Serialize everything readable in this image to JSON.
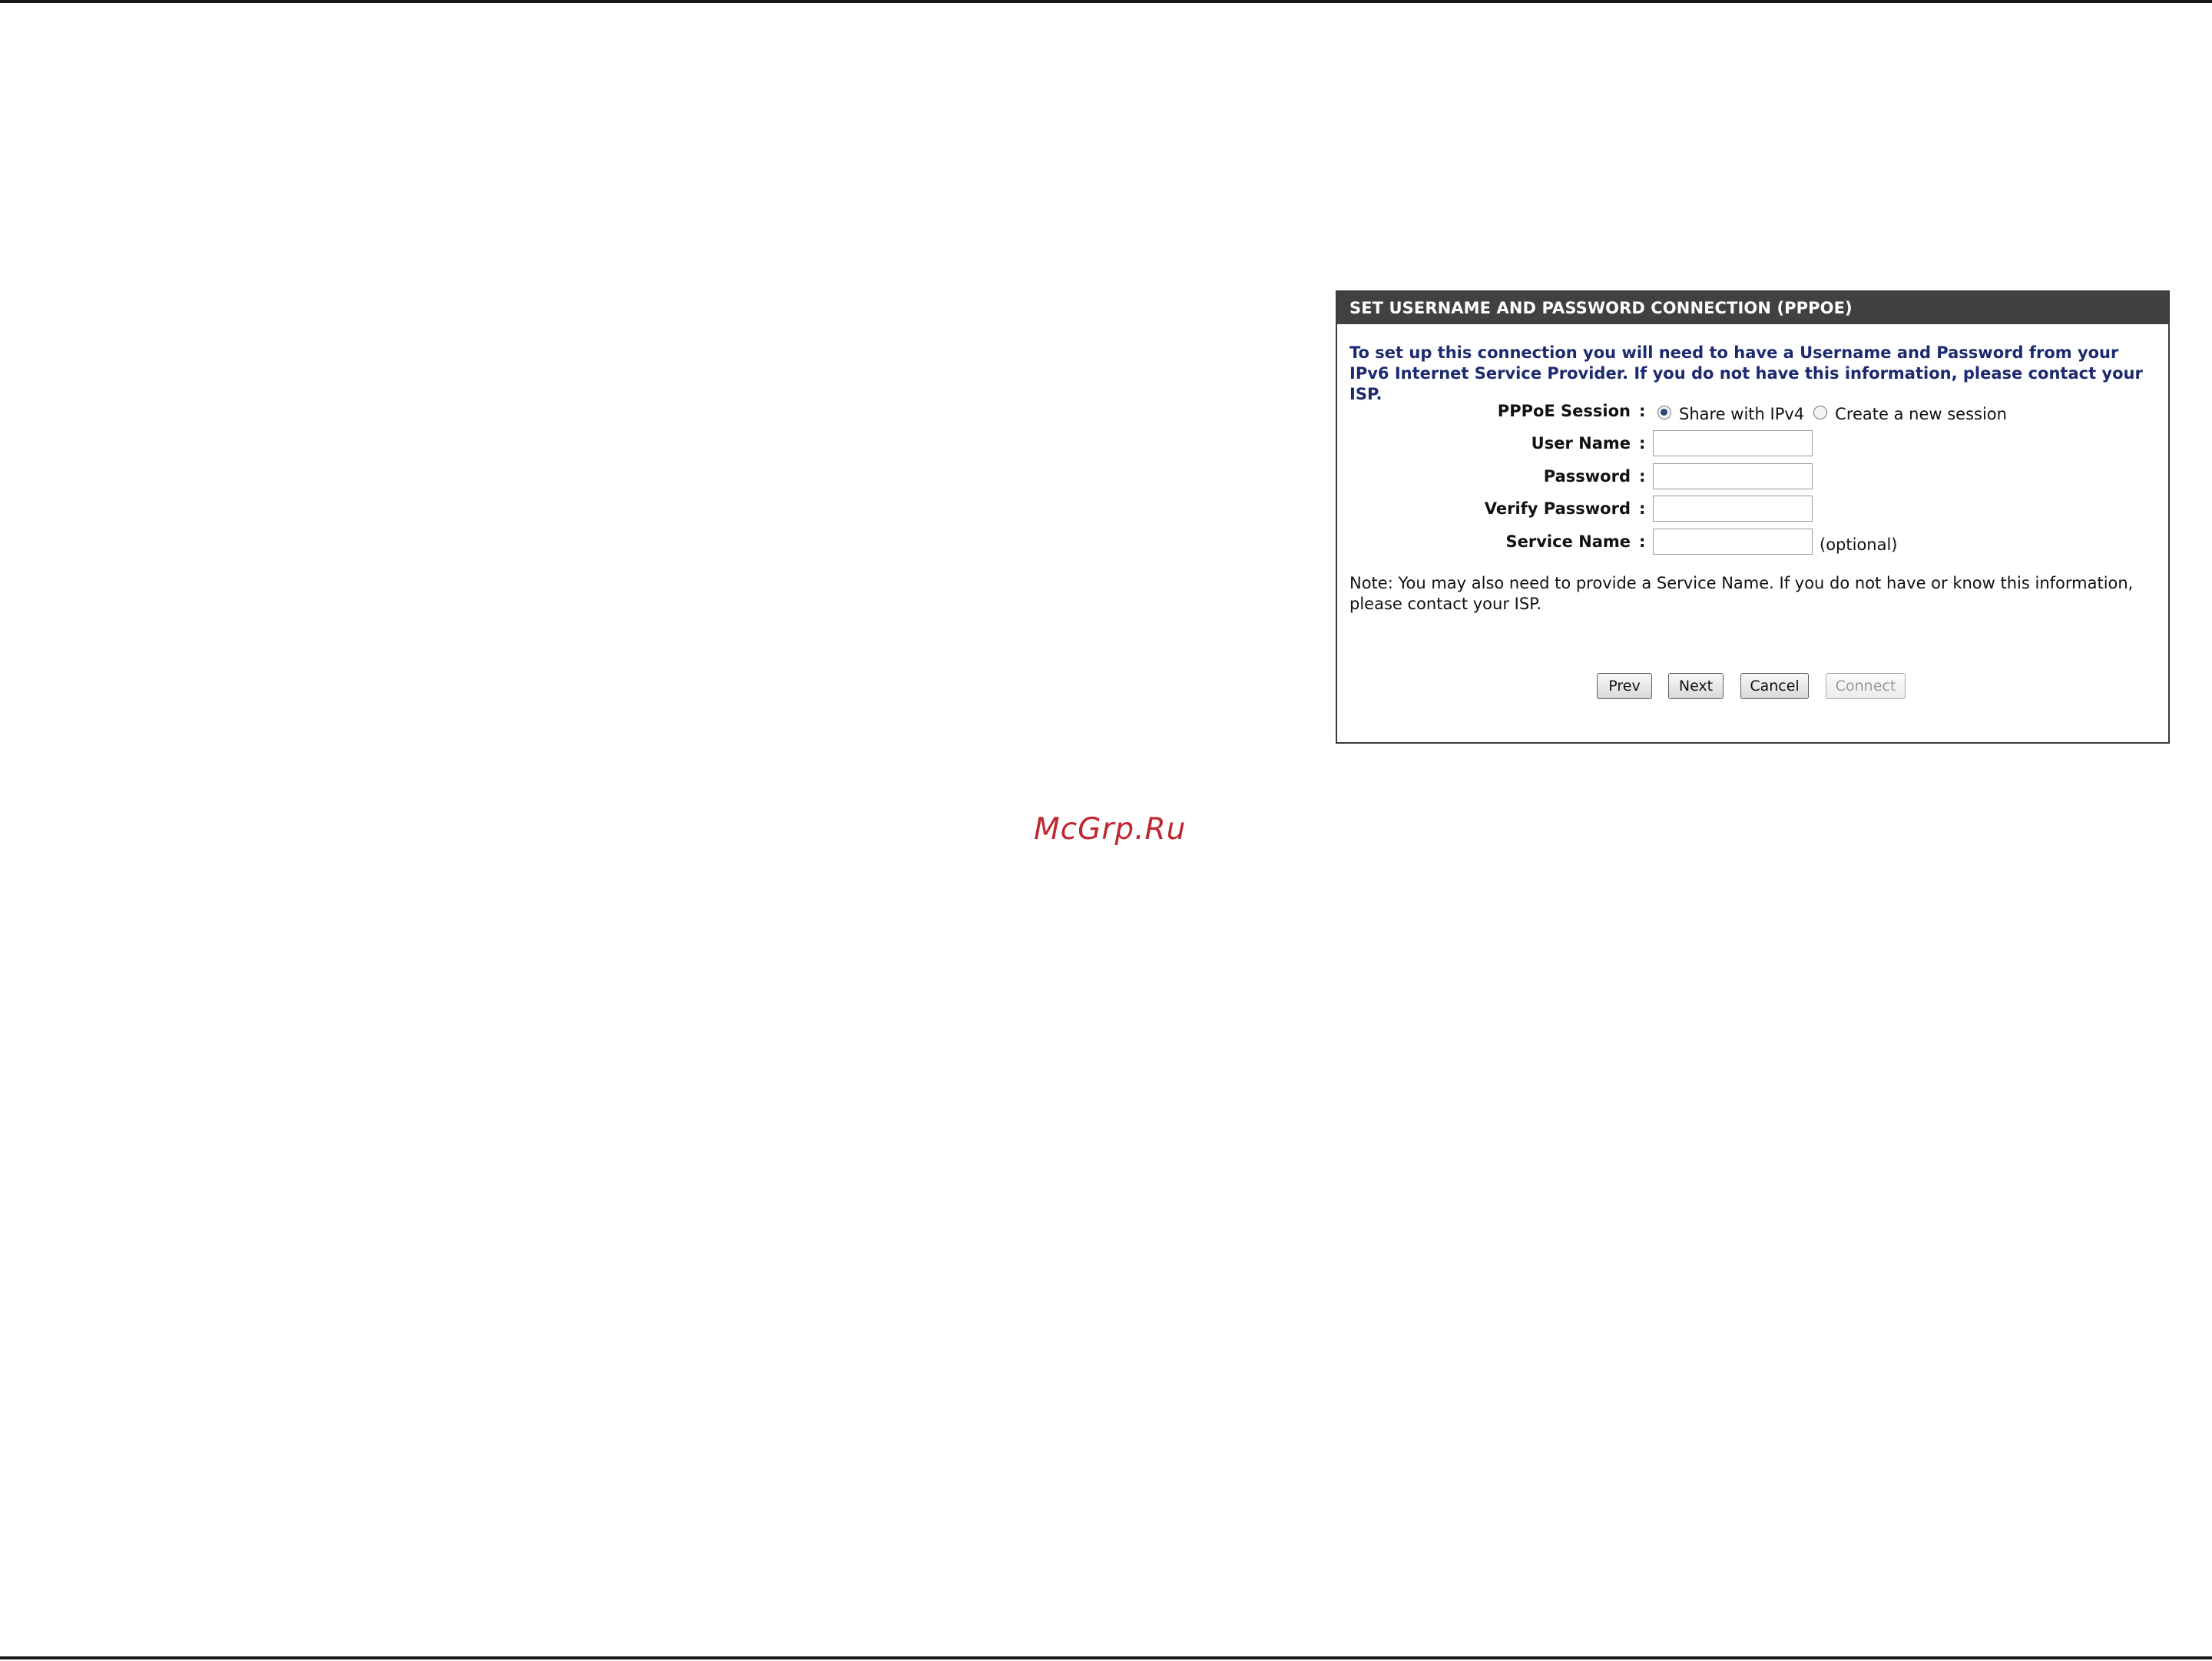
{
  "panel": {
    "title": "SET USERNAME AND PASSWORD CONNECTION (PPPOE)",
    "intro": "To set up this connection you will need to have a Username and Password from your IPv6 Internet Service Provider. If you do not have this information, please contact your ISP.",
    "colon": ":",
    "fields": {
      "pppoe_session": {
        "label": "PPPoE Session",
        "options": [
          {
            "label": "Share with IPv4",
            "checked": true
          },
          {
            "label": "Create a new session",
            "checked": false
          }
        ]
      },
      "user_name": {
        "label": "User Name",
        "value": ""
      },
      "password": {
        "label": "Password",
        "value": ""
      },
      "verify_password": {
        "label": "Verify Password",
        "value": ""
      },
      "service_name": {
        "label": "Service Name",
        "value": "",
        "hint": "(optional)"
      }
    },
    "note": "Note: You may also need to provide a Service Name. If you do not have or know this information, please contact your ISP.",
    "buttons": {
      "prev": "Prev",
      "next": "Next",
      "cancel": "Cancel",
      "connect": "Connect"
    }
  },
  "watermark": "McGrp.Ru",
  "colors": {
    "header_bg": "#414141",
    "intro_text": "#1c2a6e",
    "watermark": "#c0262f"
  }
}
